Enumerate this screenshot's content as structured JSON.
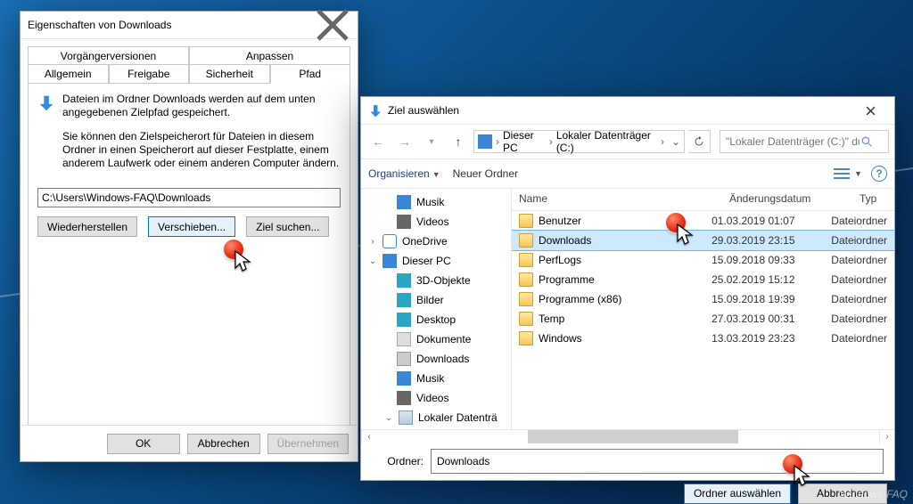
{
  "props": {
    "title": "Eigenschaften von Downloads",
    "tabs_row1": [
      "Vorgängerversionen",
      "Anpassen"
    ],
    "tabs_row2": [
      "Allgemein",
      "Freigabe",
      "Sicherheit",
      "Pfad"
    ],
    "active_tab": "Pfad",
    "heading": "Dateien im Ordner Downloads werden auf dem unten angegebenen Zielpfad gespeichert.",
    "info": "Sie können den Zielspeicherort für Dateien in diesem Ordner in einen Speicherort auf dieser Festplatte, einem anderem Laufwerk oder einem anderen Computer ändern.",
    "path_value": "C:\\Users\\Windows-FAQ\\Downloads",
    "buttons": {
      "restore": "Wiederherstellen",
      "move": "Verschieben...",
      "find": "Ziel suchen..."
    },
    "footer": {
      "ok": "OK",
      "cancel": "Abbrechen",
      "apply": "Übernehmen"
    }
  },
  "dlg": {
    "title": "Ziel auswählen",
    "crumbs": [
      "Dieser PC",
      "Lokaler Datenträger (C:)"
    ],
    "search_placeholder": "\"Lokaler Datenträger (C:)\" dur...",
    "toolbar": {
      "organize": "Organisieren",
      "newfolder": "Neuer Ordner"
    },
    "nav": [
      {
        "label": "Musik",
        "icon": "ic-music",
        "lvl": 2
      },
      {
        "label": "Videos",
        "icon": "ic-video",
        "lvl": 2
      },
      {
        "label": "OneDrive",
        "icon": "ic-cloud",
        "lvl": 1,
        "caret": "›"
      },
      {
        "label": "Dieser PC",
        "icon": "ic-pc",
        "lvl": 1,
        "caret": "⌄"
      },
      {
        "label": "3D-Objekte",
        "icon": "ic-obj",
        "lvl": 2
      },
      {
        "label": "Bilder",
        "icon": "ic-pic",
        "lvl": 2
      },
      {
        "label": "Desktop",
        "icon": "ic-desk",
        "lvl": 2
      },
      {
        "label": "Dokumente",
        "icon": "ic-doc",
        "lvl": 2
      },
      {
        "label": "Downloads",
        "icon": "ic-dl",
        "lvl": 2
      },
      {
        "label": "Musik",
        "icon": "ic-music",
        "lvl": 2
      },
      {
        "label": "Videos",
        "icon": "ic-video",
        "lvl": 2
      },
      {
        "label": "Lokaler Datenträ",
        "icon": "ic-disk",
        "lvl": 2,
        "caret": "⌄"
      }
    ],
    "columns": {
      "name": "Name",
      "date": "Änderungsdatum",
      "type": "Typ"
    },
    "rows": [
      {
        "name": "Benutzer",
        "date": "01.03.2019 01:07",
        "type": "Dateiordner"
      },
      {
        "name": "Downloads",
        "date": "29.03.2019 23:15",
        "type": "Dateiordner",
        "selected": true
      },
      {
        "name": "PerfLogs",
        "date": "15.09.2018 09:33",
        "type": "Dateiordner"
      },
      {
        "name": "Programme",
        "date": "25.02.2019 15:12",
        "type": "Dateiordner"
      },
      {
        "name": "Programme (x86)",
        "date": "15.09.2018 19:39",
        "type": "Dateiordner"
      },
      {
        "name": "Temp",
        "date": "27.03.2019 00:31",
        "type": "Dateiordner"
      },
      {
        "name": "Windows",
        "date": "13.03.2019 23:23",
        "type": "Dateiordner"
      }
    ],
    "folder_label": "Ordner:",
    "folder_value": "Downloads",
    "buttons": {
      "select": "Ordner auswählen",
      "cancel": "Abbrechen"
    },
    "help_tip": "?"
  },
  "watermark": "Windows-FAQ"
}
